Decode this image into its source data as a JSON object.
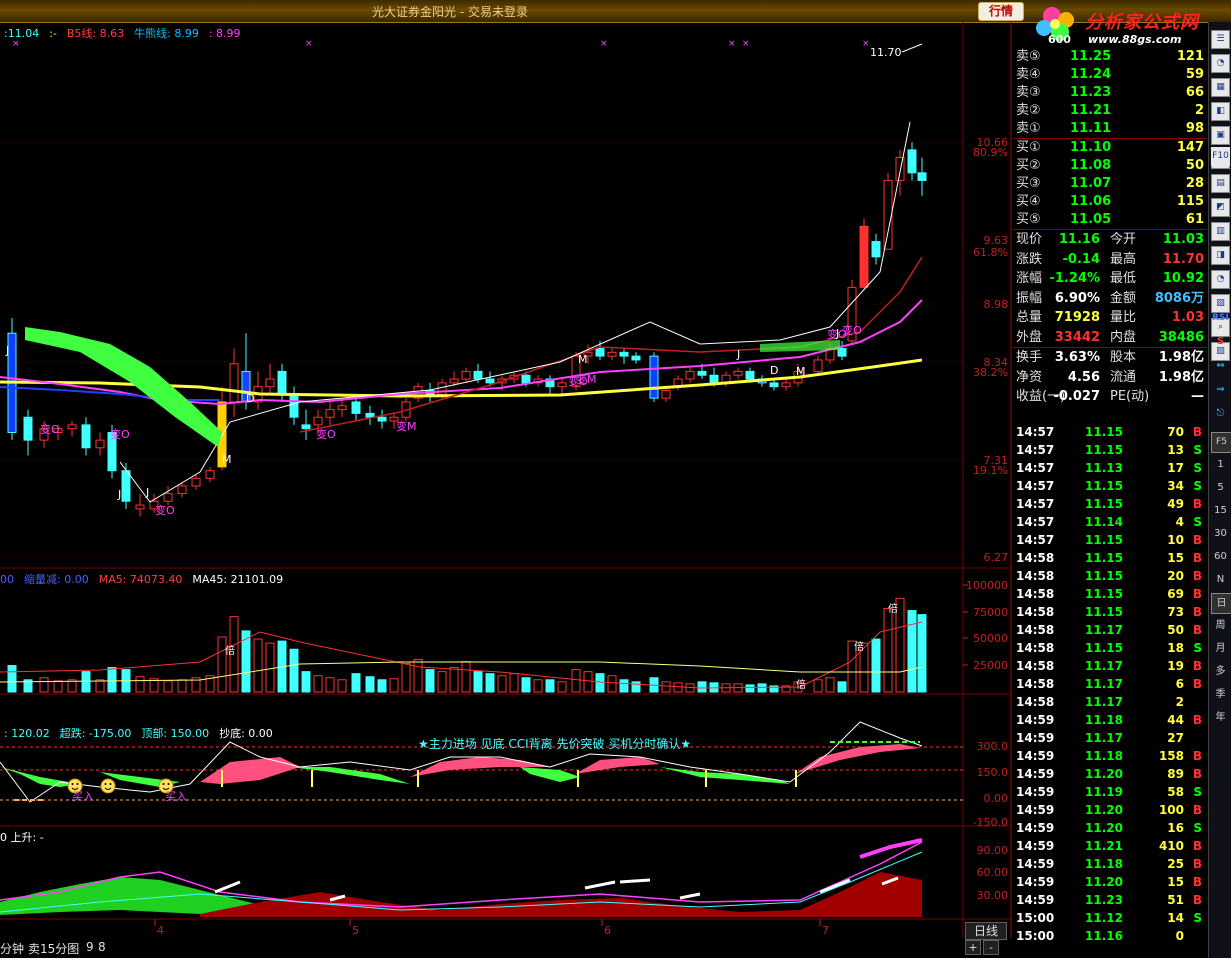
{
  "window": {
    "title": "光大证券金阳光 - 交易未登录",
    "hq_button": "行情"
  },
  "logo": {
    "brand": "分析家公式网",
    "url": "www.88gs.com",
    "code": "600"
  },
  "main_panel": {
    "indicators": [
      {
        "text": ":11.04",
        "color": "#40ffff"
      },
      {
        "text": ":-",
        "color": "#ffff00"
      },
      {
        "text": "B5线: 8.63",
        "color": "#ff4040"
      },
      {
        "text": "牛熊线: 8.99",
        "color": "#00c0ff"
      },
      {
        "text": ": 8.99",
        "color": "#ff40ff"
      }
    ],
    "price_axis": [
      "10.66",
      "80.9%",
      "9.63",
      "61.8%",
      "8.98",
      "8.34",
      "38.2%",
      "7.31",
      "19.1%",
      "6.27"
    ],
    "peak_label": "11.70",
    "signals": [
      "J",
      "变O",
      "变O",
      "J",
      "J",
      "变O",
      "M",
      "D",
      "变O",
      "变M",
      "变M",
      "M",
      "变O",
      "变O",
      "J",
      "D",
      "M",
      "变O",
      "J"
    ]
  },
  "volume_panel": {
    "indicators": [
      {
        "text": "00",
        "color": "#4060ff"
      },
      {
        "text": "缩量减: 0.00",
        "color": "#4060ff"
      },
      {
        "text": "MA5: 74073.40",
        "color": "#ff4040"
      },
      {
        "text": "MA45: 21101.09",
        "color": "#ffffff"
      }
    ],
    "axis": [
      "100000",
      "75000",
      "50000",
      "25000"
    ],
    "markers": [
      "倍",
      "倍",
      "倍",
      "倍"
    ]
  },
  "cci_panel": {
    "indicators": [
      {
        "text": ": 120.02",
        "color": "#40ffff"
      },
      {
        "text": "超跌: -175.00",
        "color": "#40ffff"
      },
      {
        "text": "顶部: 150.00",
        "color": "#40ffff"
      },
      {
        "text": "抄底: 0.00",
        "color": "#ffffff"
      }
    ],
    "axis": [
      "300.0",
      "150.0",
      "0.00",
      "-150.0"
    ],
    "banner": "★主力进场 见底 CCI背离 先价突破 买机分时确认★",
    "buy_labels": [
      "买入",
      "买入"
    ]
  },
  "trend_panel": {
    "indicators": [
      {
        "text": "0 上升: -",
        "color": "#ffffff"
      }
    ],
    "axis": [
      "90.00",
      "60.00",
      "30.00"
    ]
  },
  "date_axis": [
    "4",
    "5",
    "6",
    "7"
  ],
  "bottom": {
    "labels": [
      "分钟",
      "卖15分图",
      "9",
      "8"
    ],
    "daily_tab": "日线",
    "zoom_plus": "+",
    "zoom_minus": "-"
  },
  "order_book": {
    "sell": [
      {
        "label": "卖⑤",
        "price": "11.25",
        "vol": "121"
      },
      {
        "label": "卖④",
        "price": "11.24",
        "vol": "59"
      },
      {
        "label": "卖③",
        "price": "11.23",
        "vol": "66"
      },
      {
        "label": "卖②",
        "price": "11.21",
        "vol": "2"
      },
      {
        "label": "卖①",
        "price": "11.11",
        "vol": "98"
      }
    ],
    "buy": [
      {
        "label": "买①",
        "price": "11.10",
        "vol": "147"
      },
      {
        "label": "买②",
        "price": "11.08",
        "vol": "50"
      },
      {
        "label": "买③",
        "price": "11.07",
        "vol": "28"
      },
      {
        "label": "买④",
        "price": "11.06",
        "vol": "115"
      },
      {
        "label": "买⑤",
        "price": "11.05",
        "vol": "61"
      }
    ]
  },
  "stats": [
    {
      "l1": "现价",
      "v1": "11.16",
      "c1": "#00ff00",
      "l2": "今开",
      "v2": "11.03",
      "c2": "#00ff00"
    },
    {
      "l1": "涨跌",
      "v1": "-0.14",
      "c1": "#00ff00",
      "l2": "最高",
      "v2": "11.70",
      "c2": "#ff3030"
    },
    {
      "l1": "涨幅",
      "v1": "-1.24%",
      "c1": "#00ff00",
      "l2": "最低",
      "v2": "10.92",
      "c2": "#00ff00"
    },
    {
      "l1": "振幅",
      "v1": "6.90%",
      "c1": "#ffffff",
      "l2": "金额",
      "v2": "8086万",
      "c2": "#40c0ff"
    },
    {
      "l1": "总量",
      "v1": "71928",
      "c1": "#ffff40",
      "l2": "量比",
      "v2": "1.03",
      "c2": "#ff3030"
    },
    {
      "l1": "外盘",
      "v1": "33442",
      "c1": "#ff3030",
      "l2": "内盘",
      "v2": "38486",
      "c2": "#00ff00"
    },
    {
      "l1": "换手",
      "v1": "3.63%",
      "c1": "#ffffff",
      "l2": "股本",
      "v2": "1.98亿",
      "c2": "#ffffff"
    },
    {
      "l1": "净资",
      "v1": "4.56",
      "c1": "#ffffff",
      "l2": "流通",
      "v2": "1.98亿",
      "c2": "#ffffff"
    },
    {
      "l1": "收益(一)",
      "v1": "-0.027",
      "c1": "#ffffff",
      "l2": "PE(动)",
      "v2": "—",
      "c2": "#ffffff"
    }
  ],
  "trades": [
    {
      "time": "14:57",
      "price": "11.15",
      "vol": "70",
      "bs": "B"
    },
    {
      "time": "14:57",
      "price": "11.15",
      "vol": "13",
      "bs": "S"
    },
    {
      "time": "14:57",
      "price": "11.13",
      "vol": "17",
      "bs": "S"
    },
    {
      "time": "14:57",
      "price": "11.15",
      "vol": "34",
      "bs": "S"
    },
    {
      "time": "14:57",
      "price": "11.15",
      "vol": "49",
      "bs": "B"
    },
    {
      "time": "14:57",
      "price": "11.14",
      "vol": "4",
      "bs": "S"
    },
    {
      "time": "14:57",
      "price": "11.15",
      "vol": "10",
      "bs": "B"
    },
    {
      "time": "14:58",
      "price": "11.15",
      "vol": "15",
      "bs": "B"
    },
    {
      "time": "14:58",
      "price": "11.15",
      "vol": "20",
      "bs": "B"
    },
    {
      "time": "14:58",
      "price": "11.15",
      "vol": "69",
      "bs": "B"
    },
    {
      "time": "14:58",
      "price": "11.15",
      "vol": "73",
      "bs": "B"
    },
    {
      "time": "14:58",
      "price": "11.17",
      "vol": "50",
      "bs": "B"
    },
    {
      "time": "14:58",
      "price": "11.15",
      "vol": "18",
      "bs": "S"
    },
    {
      "time": "14:58",
      "price": "11.17",
      "vol": "19",
      "bs": "B"
    },
    {
      "time": "14:58",
      "price": "11.17",
      "vol": "6",
      "bs": "B"
    },
    {
      "time": "14:58",
      "price": "11.17",
      "vol": "2",
      "bs": ""
    },
    {
      "time": "14:59",
      "price": "11.18",
      "vol": "44",
      "bs": "B"
    },
    {
      "time": "14:59",
      "price": "11.17",
      "vol": "27",
      "bs": ""
    },
    {
      "time": "14:59",
      "price": "11.18",
      "vol": "158",
      "bs": "B"
    },
    {
      "time": "14:59",
      "price": "11.20",
      "vol": "89",
      "bs": "B"
    },
    {
      "time": "14:59",
      "price": "11.19",
      "vol": "58",
      "bs": "S"
    },
    {
      "time": "14:59",
      "price": "11.20",
      "vol": "100",
      "bs": "B"
    },
    {
      "time": "14:59",
      "price": "11.20",
      "vol": "16",
      "bs": "S"
    },
    {
      "time": "14:59",
      "price": "11.21",
      "vol": "410",
      "bs": "B"
    },
    {
      "time": "14:59",
      "price": "11.18",
      "vol": "25",
      "bs": "B"
    },
    {
      "time": "14:59",
      "price": "11.20",
      "vol": "15",
      "bs": "B"
    },
    {
      "time": "14:59",
      "price": "11.23",
      "vol": "51",
      "bs": "B"
    },
    {
      "time": "15:00",
      "price": "11.12",
      "vol": "14",
      "bs": "S"
    },
    {
      "time": "15:00",
      "price": "11.16",
      "vol": "0",
      "bs": ""
    }
  ],
  "sidebar": {
    "icons": [
      "F10",
      "RSI",
      "S"
    ],
    "periods": [
      "F5",
      "1",
      "5",
      "15",
      "30",
      "60",
      "N",
      "日",
      "周",
      "月",
      "多",
      "季",
      "年"
    ]
  },
  "colors": {
    "up": "#ff3030",
    "down": "#00ff00",
    "cyan": "#40ffff",
    "yellow": "#ffff40",
    "magenta": "#ff40ff",
    "grid": "#8b0000"
  }
}
